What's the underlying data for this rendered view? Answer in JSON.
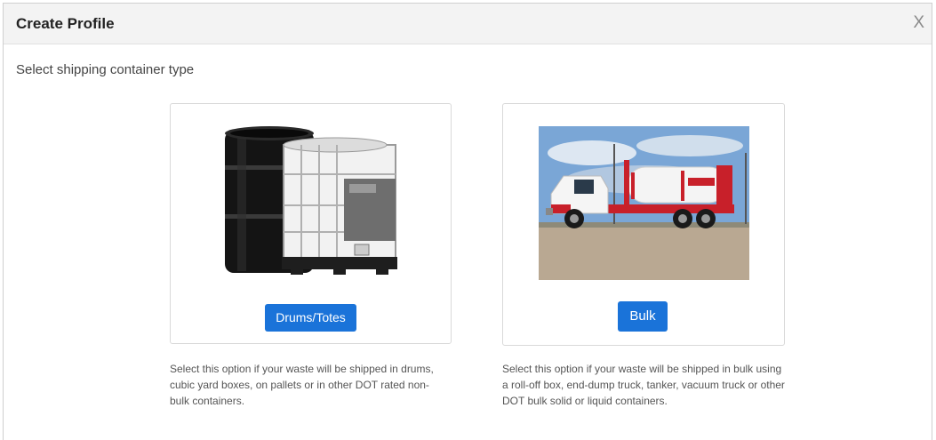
{
  "modal": {
    "title": "Create Profile",
    "close_label": "X",
    "prompt": "Select shipping container type"
  },
  "options": [
    {
      "button_label": "Drums/Totes",
      "image": "drums-totes-image",
      "description": "Select this option if your waste will be shipped in drums, cubic yard boxes, on pallets or in other DOT rated non-bulk containers."
    },
    {
      "button_label": "Bulk",
      "image": "vacuum-truck-image",
      "description": "Select this option if your waste will be shipped in bulk using a roll-off box, end-dump truck, tanker, vacuum truck or other DOT bulk solid or liquid containers."
    }
  ],
  "colors": {
    "accent": "#1a73d9",
    "header_bg": "#f3f3f3",
    "truck_red": "#c8202a"
  }
}
